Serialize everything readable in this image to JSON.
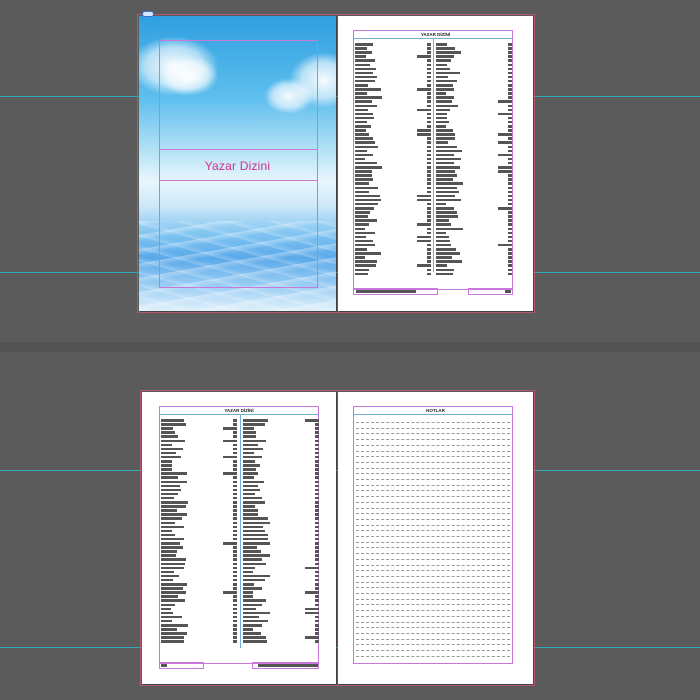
{
  "cover": {
    "title": "Yazar Dizini"
  },
  "index_pages": [
    {
      "heading": "YAZAR DİZİNİ"
    },
    {
      "heading": "YAZAR DİZİNİ"
    }
  ],
  "notes_page": {
    "heading": "NOTLAR"
  },
  "colors": {
    "pasteboard": "#5b5b5b",
    "guide": "#2bb7c8",
    "margin": "#c778d8",
    "cover_title": "#d0308c",
    "spread_border": "#b35a6a"
  }
}
